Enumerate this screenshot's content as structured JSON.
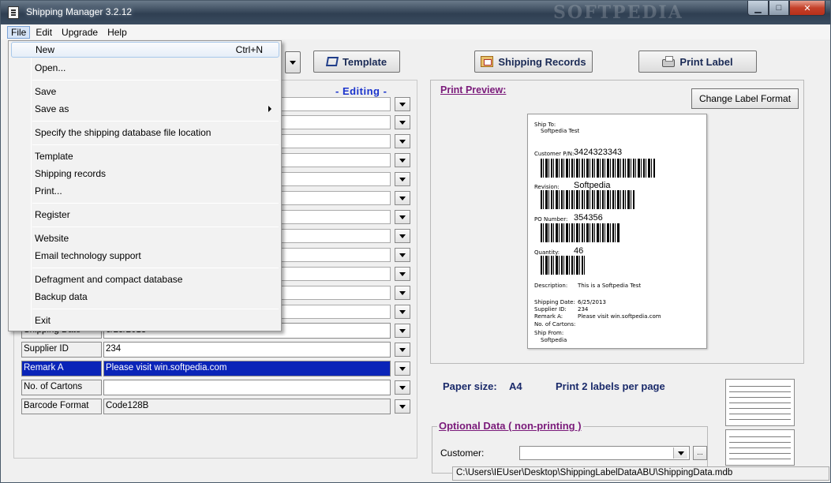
{
  "window": {
    "title": "Shipping Manager 3.2.12",
    "watermark": "SOFTPEDIA",
    "buttons": {
      "minimize": "▁",
      "maximize": "□",
      "close": "✕"
    }
  },
  "menubar": {
    "items": [
      "File",
      "Edit",
      "Upgrade",
      "Help"
    ],
    "active": "File"
  },
  "file_menu": {
    "new": {
      "label": "New",
      "shortcut": "Ctrl+N"
    },
    "open": "Open...",
    "save": "Save",
    "save_as": "Save as",
    "specify_db": "Specify the shipping database file location",
    "template": "Template",
    "shipping_records": "Shipping records",
    "print": "Print...",
    "register": "Register",
    "website": "Website",
    "email_support": "Email technology support",
    "defragment": "Defragment and compact database",
    "backup": "Backup data",
    "exit": "Exit"
  },
  "toolbar": {
    "template": "Template",
    "shipping_records": "Shipping Records",
    "print_label": "Print Label"
  },
  "form": {
    "editing": "- Editing -",
    "rows": [
      {
        "label": "Shipping Date",
        "value": "6/25/2013"
      },
      {
        "label": "Supplier ID",
        "value": "234"
      },
      {
        "label": "Remark A",
        "value": "Please visit win.softpedia.com"
      },
      {
        "label": "No. of Cartons",
        "value": ""
      },
      {
        "label": "Barcode Format",
        "value": "Code128B"
      }
    ]
  },
  "preview": {
    "title": "Print Preview:",
    "change_format": "Change Label Format",
    "label": {
      "ship_to_label": "Ship To:",
      "ship_to_value": "Softpedia Test",
      "customer_pn_label": "Customer P/N:",
      "customer_pn_value": "3424323343",
      "revision_label": "Revision:",
      "revision_value": "Softpedia",
      "po_label": "PO Number:",
      "po_value": "354356",
      "quantity_label": "Quantity:",
      "quantity_value": "46",
      "description_label": "Description:",
      "description_value": "This is a Softpedia Test",
      "shipping_date_label": "Shipping Date:",
      "shipping_date_value": "6/25/2013",
      "supplier_label": "Supplier ID:",
      "supplier_value": "234",
      "remark_label": "Remark A:",
      "remark_value": "Please visit win.softpedia.com",
      "cartons_label": "No. of Cartons:",
      "ship_from_label": "Ship From:",
      "ship_from_value": "Softpedia"
    }
  },
  "paper": {
    "size_label": "Paper size:",
    "size_value": "A4",
    "per_page": "Print 2 labels per page"
  },
  "optional": {
    "title": "Optional Data  ( non-printing )",
    "customer_label": "Customer:",
    "ellipsis": "..."
  },
  "status": {
    "path": "C:\\Users\\IEUser\\Desktop\\ShippingLabelDataABU\\ShippingData.mdb"
  },
  "colors": {
    "selection": "#0a24b8",
    "accent_purple": "#7a1a7a",
    "editing_blue": "#1a33cc"
  }
}
